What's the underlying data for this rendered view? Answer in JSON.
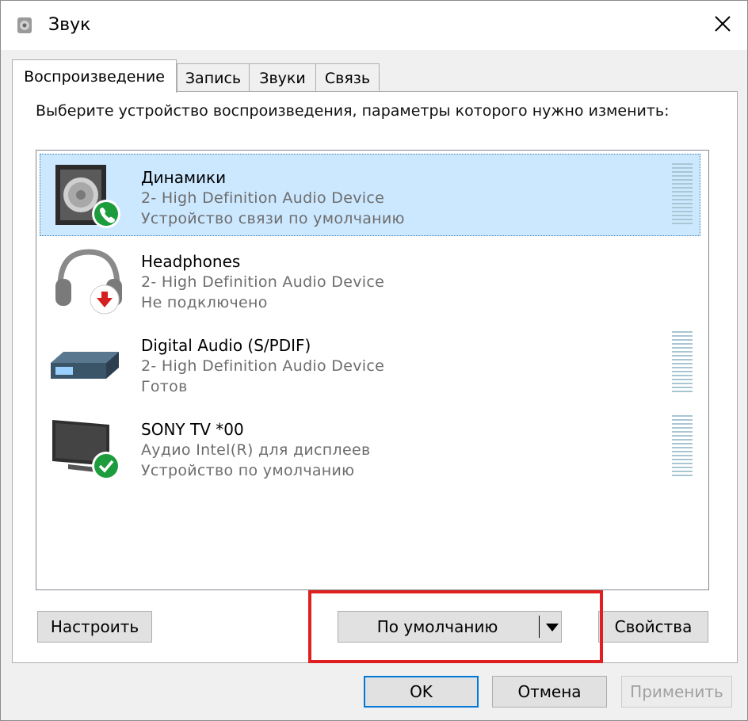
{
  "window": {
    "title": "Звук",
    "app_icon": "speaker-icon",
    "close_icon": "close-icon"
  },
  "tabs": [
    {
      "label": "Воспроизведение",
      "active": true
    },
    {
      "label": "Запись",
      "active": false
    },
    {
      "label": "Звуки",
      "active": false
    },
    {
      "label": "Связь",
      "active": false
    }
  ],
  "instruction": "Выберите устройство воспроизведения, параметры которого нужно изменить:",
  "devices": [
    {
      "name": "Динамики",
      "description": "2- High Definition Audio Device",
      "status": "Устройство связи по умолчанию",
      "icon": "speaker-device-icon",
      "badge": "green-phone-badge-icon",
      "selected": true
    },
    {
      "name": "Headphones",
      "description": "2- High Definition Audio Device",
      "status": "Не подключено",
      "icon": "headphones-icon",
      "badge": "red-down-arrow-badge-icon",
      "selected": false
    },
    {
      "name": "Digital Audio (S/PDIF)",
      "description": "2- High Definition Audio Device",
      "status": "Готов",
      "icon": "digital-audio-device-icon",
      "badge": "",
      "selected": false
    },
    {
      "name": "SONY TV  *00",
      "description": "Аудио Intel(R) для дисплеев",
      "status": "Устройство по умолчанию",
      "icon": "tv-monitor-icon",
      "badge": "green-check-badge-icon",
      "selected": false
    }
  ],
  "buttons": {
    "configure": "Настроить",
    "set_default": "По умолчанию",
    "properties": "Свойства",
    "ok": "OK",
    "cancel": "Отмена",
    "apply": "Применить"
  },
  "colors": {
    "selection": "#cce8ff",
    "highlight": "#e02020",
    "accent": "#0078d7"
  }
}
